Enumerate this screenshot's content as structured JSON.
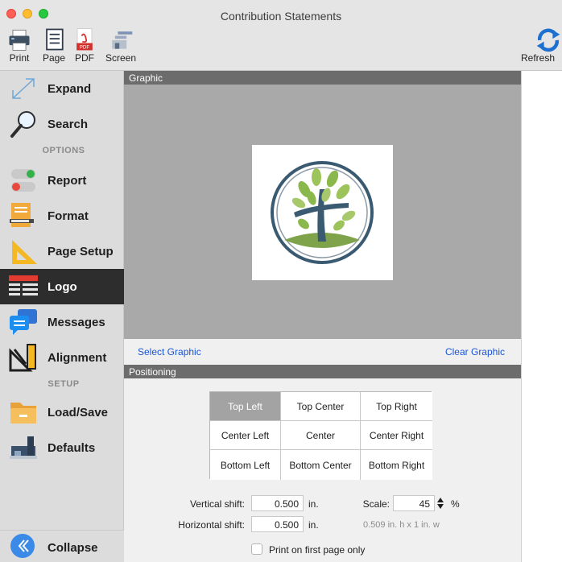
{
  "window": {
    "title": "Contribution Statements"
  },
  "toolbar": {
    "print": "Print",
    "page": "Page",
    "pdf": "PDF",
    "pdf_badge": "PDF",
    "screen": "Screen",
    "refresh": "Refresh"
  },
  "sidebar": {
    "expand": "Expand",
    "search": "Search",
    "options_header": "OPTIONS",
    "report": "Report",
    "format": "Format",
    "page_setup": "Page Setup",
    "logo": "Logo",
    "messages": "Messages",
    "alignment": "Alignment",
    "setup_header": "SETUP",
    "load_save": "Load/Save",
    "defaults": "Defaults",
    "collapse": "Collapse",
    "active_item": "Logo"
  },
  "graphic": {
    "header": "Graphic",
    "select": "Select Graphic",
    "clear": "Clear Graphic"
  },
  "positioning": {
    "header": "Positioning",
    "cells": [
      "Top Left",
      "Top Center",
      "Top Right",
      "Center Left",
      "Center",
      "Center Right",
      "Bottom Left",
      "Bottom Center",
      "Bottom Right"
    ],
    "selected": "Top Left",
    "vertical_shift_label": "Vertical shift:",
    "vertical_shift_value": "0.500",
    "horizontal_shift_label": "Horizontal shift:",
    "horizontal_shift_value": "0.500",
    "unit": "in.",
    "scale_label": "Scale:",
    "scale_value": "45",
    "scale_unit": "%",
    "size_hint": "0.509 in. h x 1 in. w",
    "first_page_label": "Print on first page only",
    "first_page_checked": false
  },
  "colors": {
    "accent": "#1b55d4",
    "sidebar_active": "#2d2d2d",
    "section_header": "#6c6c6c",
    "graphic_bg": "#a9a9a9"
  }
}
